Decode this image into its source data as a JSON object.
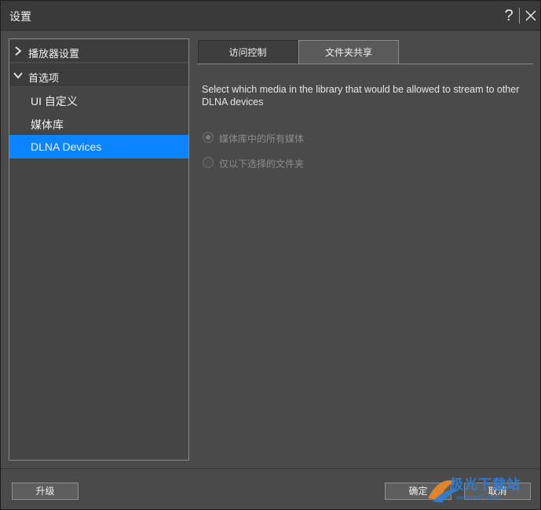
{
  "window": {
    "title": "设置"
  },
  "sidebar": {
    "groups": [
      {
        "label": "播放器设置",
        "expanded": false
      },
      {
        "label": "首选项",
        "expanded": true
      }
    ],
    "items": [
      {
        "label": "UI 自定义"
      },
      {
        "label": "媒体库"
      },
      {
        "label": "DLNA Devices",
        "selected": true
      }
    ]
  },
  "tabs": [
    {
      "label": "访问控制",
      "active": false
    },
    {
      "label": "文件夹共享",
      "active": true
    }
  ],
  "content": {
    "description": "Select which media in the library that would be allowed to stream to other DLNA devices",
    "options": [
      {
        "label": "媒体库中的所有媒体",
        "checked": true
      },
      {
        "label": "仅以下选择的文件夹",
        "checked": false
      }
    ]
  },
  "buttons": {
    "upgrade": "升级",
    "ok": "确定",
    "cancel": "取消"
  },
  "watermark": {
    "text": "极光下载站",
    "sub": "www.xz7.com"
  },
  "colors": {
    "selection": "#0a84ff",
    "background": "#4a4a4a",
    "watermark": "#2d7fd8"
  }
}
